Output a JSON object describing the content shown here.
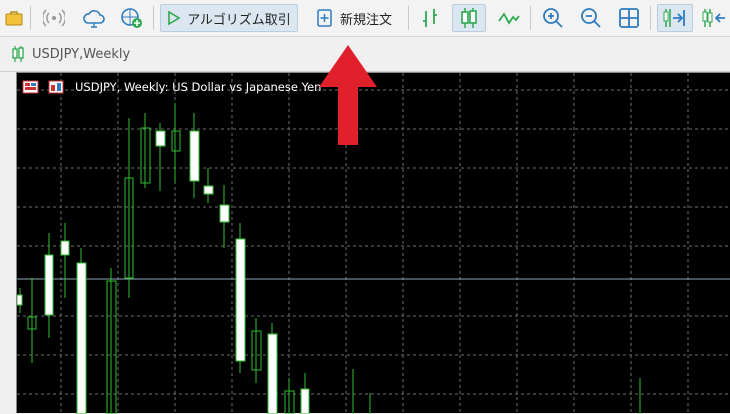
{
  "toolbar": {
    "algo_trading_label": "アルゴリズム取引",
    "new_order_label": "新規注文"
  },
  "tab": {
    "label": "USDJPY,Weekly"
  },
  "chart_header": {
    "text": "USDJPY, Weekly:  US Dollar vs Japanese Yen"
  },
  "colors": {
    "chart_bg": "#000000",
    "grid": "#6b6b6b",
    "candle_bull_fill": "#ffffff",
    "candle_outline": "#2fbf2f",
    "annotation_arrow": "#e0202b",
    "toolbar_icon": "#2f7cc0"
  },
  "icons": [
    "briefcase-icon",
    "signal-icon",
    "cloud-icon",
    "globe-add-icon",
    "play-icon",
    "new-order-icon",
    "bar-chart-icon",
    "candlestick-icon",
    "line-chart-icon",
    "zoom-in-icon",
    "zoom-out-icon",
    "tile-windows-icon",
    "shift-end-icon",
    "autoscroll-icon"
  ]
}
